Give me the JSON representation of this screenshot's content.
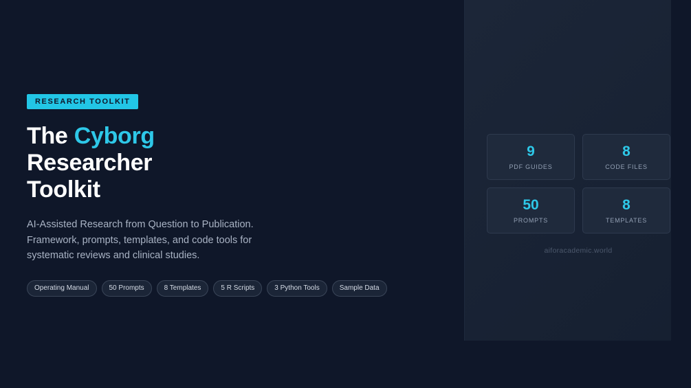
{
  "hero": {
    "badge": "RESEARCH TOOLKIT",
    "title_prefix": "The ",
    "title_accent": "Cyborg",
    "title_line2": "Researcher",
    "title_line3": "Toolkit",
    "description_line1": "AI-Assisted Research from Question to Publication.",
    "description_line2": "Framework, prompts, templates, and code tools for",
    "description_line3": "systematic reviews and clinical studies.",
    "chips": [
      "Operating Manual",
      "50 Prompts",
      "8 Templates",
      "5 R Scripts",
      "3 Python Tools",
      "Sample Data"
    ]
  },
  "stats": [
    {
      "value": "9",
      "label": "PDF GUIDES"
    },
    {
      "value": "8",
      "label": "CODE FILES"
    },
    {
      "value": "50",
      "label": "PROMPTS"
    },
    {
      "value": "8",
      "label": "TEMPLATES"
    }
  ],
  "site": "aiforacademic.world",
  "colors": {
    "background": "#0f1729",
    "accent": "#2ec8e8",
    "badge": "#22c6e6"
  }
}
